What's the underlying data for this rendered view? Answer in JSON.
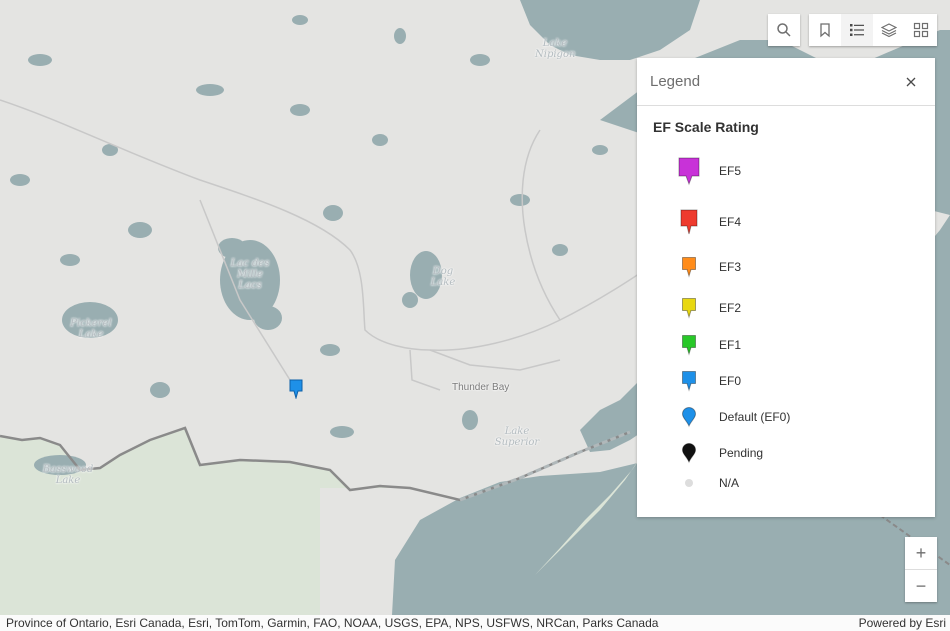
{
  "map": {
    "labels": {
      "lake_nipigon": [
        "Lake",
        "Nipigon"
      ],
      "lac_des_mille_lacs": [
        "Lac des",
        "Mille",
        "Lacs"
      ],
      "dog_lake": [
        "Dog",
        "Lake"
      ],
      "pickerel_lake": [
        "Pickerel",
        "Lake"
      ],
      "thunder_bay": "Thunder Bay",
      "lake_superior": [
        "Lake",
        "Superior"
      ],
      "basswood_lake": [
        "Basswood",
        "Lake"
      ]
    },
    "marker": {
      "category": "EF0",
      "color": "#1e90e8"
    },
    "colors": {
      "water": "#99aeb1",
      "land": "#e4e4e2",
      "us_land": "#dbe4d7",
      "border": "#8a8a8a",
      "road": "#c8c8c8"
    }
  },
  "toolbar": {
    "search_icon": "search-icon",
    "bookmark_icon": "bookmark-icon",
    "legend_icon": "list-icon",
    "layers_icon": "layers-icon",
    "basemap_icon": "grid-icon"
  },
  "legend": {
    "title": "Legend",
    "layer_title": "EF Scale Rating",
    "items": [
      {
        "label": "EF5",
        "color": "#c832d8",
        "shape": "pin-large"
      },
      {
        "label": "EF4",
        "color": "#ee3b2e",
        "shape": "pin-medium"
      },
      {
        "label": "EF3",
        "color": "#ff8c1a",
        "shape": "pin-small"
      },
      {
        "label": "EF2",
        "color": "#e8d810",
        "shape": "pin-small"
      },
      {
        "label": "EF1",
        "color": "#28c828",
        "shape": "pin-small"
      },
      {
        "label": "EF0",
        "color": "#1e90e8",
        "shape": "pin-small"
      },
      {
        "label": "Default (EF0)",
        "color": "#1e90e8",
        "shape": "pin-round"
      },
      {
        "label": "Pending",
        "color": "#111111",
        "shape": "pin-round"
      },
      {
        "label": "N/A",
        "color": "#dddddd",
        "shape": "dot"
      }
    ]
  },
  "zoom": {
    "in": "+",
    "out": "−"
  },
  "attribution": {
    "sources": "Province of Ontario, Esri Canada, Esri, TomTom, Garmin, FAO, NOAA, USGS, EPA, NPS, USFWS, NRCan, Parks Canada",
    "powered_by": "Powered by Esri"
  }
}
